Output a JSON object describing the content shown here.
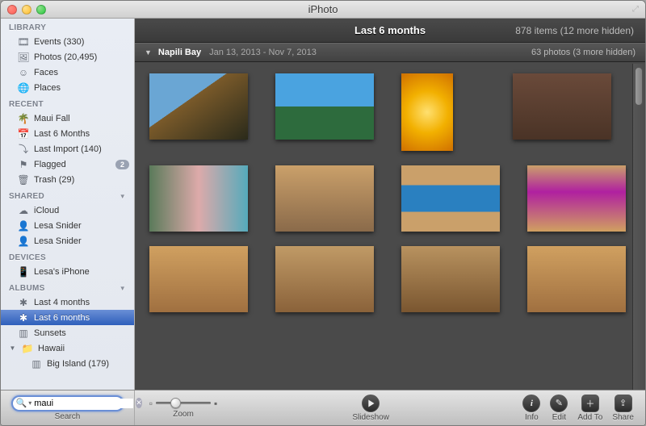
{
  "window": {
    "title": "iPhoto"
  },
  "sidebar": {
    "groups": [
      {
        "label": "LIBRARY",
        "items": [
          {
            "icon": "events-icon",
            "label": "Events (330)"
          },
          {
            "icon": "photos-icon",
            "label": "Photos (20,495)"
          },
          {
            "icon": "faces-icon",
            "label": "Faces"
          },
          {
            "icon": "places-icon",
            "label": "Places"
          }
        ]
      },
      {
        "label": "RECENT",
        "items": [
          {
            "icon": "palm-icon",
            "label": "Maui Fall"
          },
          {
            "icon": "calendar-icon",
            "label": "Last 6 Months"
          },
          {
            "icon": "import-icon",
            "label": "Last Import (140)"
          },
          {
            "icon": "flag-icon",
            "label": "Flagged",
            "badge": "2"
          },
          {
            "icon": "trash-icon",
            "label": "Trash (29)"
          }
        ]
      },
      {
        "label": "SHARED",
        "items": [
          {
            "icon": "cloud-icon",
            "label": "iCloud"
          },
          {
            "icon": "person-icon",
            "label": "Lesa Snider"
          },
          {
            "icon": "person-icon",
            "label": "Lesa Snider"
          }
        ]
      },
      {
        "label": "DEVICES",
        "items": [
          {
            "icon": "iphone-icon",
            "label": "Lesa's iPhone"
          }
        ]
      },
      {
        "label": "ALBUMS",
        "items": [
          {
            "icon": "smart-album-icon",
            "label": "Last 4 months"
          },
          {
            "icon": "smart-album-icon",
            "label": "Last 6 months",
            "selected": true
          },
          {
            "icon": "album-icon",
            "label": "Sunsets"
          },
          {
            "icon": "folder-icon",
            "label": "Hawaii",
            "expanded": true
          },
          {
            "icon": "album-icon",
            "label": "Big Island (179)",
            "indent": true
          }
        ]
      }
    ]
  },
  "header": {
    "title": "Last 6 months",
    "count": "878 items (12 more hidden)"
  },
  "event": {
    "name": "Napili Bay",
    "date": "Jan 13, 2013 - Nov 7, 2013",
    "count": "63 photos (3 more hidden)"
  },
  "toolbar": {
    "search_label": "Search",
    "zoom_label": "Zoom",
    "slideshow_label": "Slideshow",
    "info_label": "Info",
    "edit_label": "Edit",
    "addto_label": "Add To",
    "share_label": "Share",
    "search_value": "maui"
  }
}
